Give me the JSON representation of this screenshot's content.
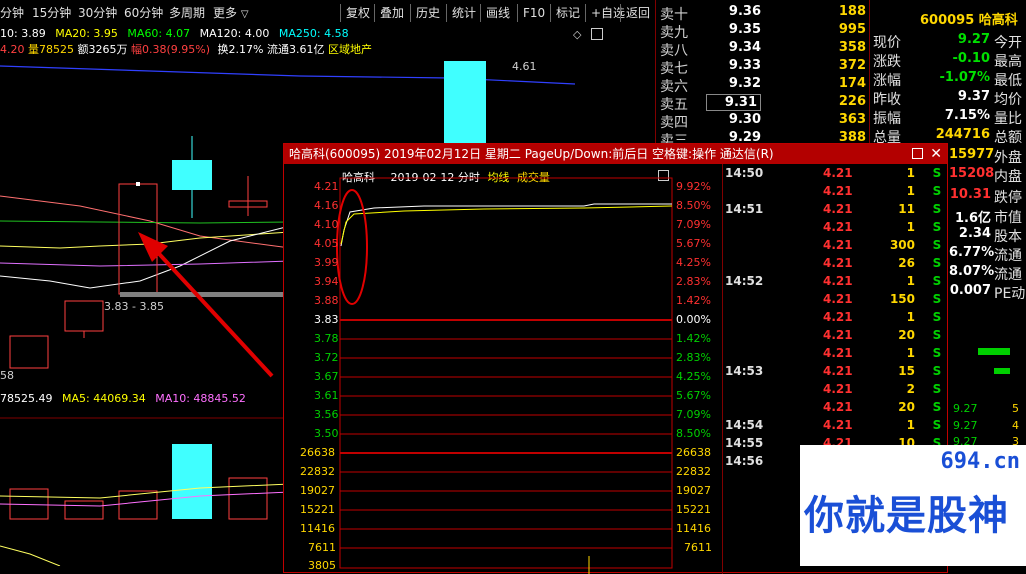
{
  "toolbar": {
    "periods": [
      "分钟",
      "15分钟",
      "30分钟",
      "60分钟",
      "多周期",
      "更多"
    ],
    "buttons": [
      "复权",
      "叠加",
      "历史",
      "统计",
      "画线",
      "F10",
      "标记",
      "+自选",
      "返回"
    ]
  },
  "main_chart": {
    "ma_line": [
      "10: 3.89",
      "MA20: 3.95",
      "MA60: 4.07",
      "MA120: 4.00",
      "MA250: 4.58"
    ],
    "info_line": {
      "price": "4.20",
      "vol": "量78525",
      "amount": "额3265万",
      "change": "幅0.38(9.95%)",
      "turnover": "换2.17%",
      "float": "流通3.61亿",
      "sector": "区域地产"
    },
    "high_label": "4.61",
    "low_label": "3.83 - 3.85",
    "left_low": "58",
    "vol_line": [
      "78525.49",
      "MA5: 44069.34",
      "MA10: 48845.52"
    ]
  },
  "quote": {
    "asks": [
      {
        "label": "卖十",
        "price": "9.36",
        "vol": "188"
      },
      {
        "label": "卖九",
        "price": "9.35",
        "vol": "995"
      },
      {
        "label": "卖八",
        "price": "9.34",
        "vol": "358"
      },
      {
        "label": "卖七",
        "price": "9.33",
        "vol": "372"
      },
      {
        "label": "卖六",
        "price": "9.32",
        "vol": "174"
      },
      {
        "label": "卖五",
        "price": "9.31",
        "vol": "226"
      },
      {
        "label": "卖四",
        "price": "9.30",
        "vol": "363"
      },
      {
        "label": "卖三",
        "price": "9.29",
        "vol": "388"
      }
    ]
  },
  "stats": {
    "code_name": "600095 哈高科",
    "rows": [
      {
        "label": "现价",
        "value": "9.27",
        "right": "今开"
      },
      {
        "label": "涨跌",
        "value": "-0.10",
        "right": "最高"
      },
      {
        "label": "涨幅",
        "value": "-1.07%",
        "right": "最低"
      },
      {
        "label": "昨收",
        "value": "9.37",
        "right": "均价"
      },
      {
        "label": "振幅",
        "value": "7.15%",
        "right": "量比"
      },
      {
        "label": "总量",
        "value": "244716",
        "right": "总额"
      }
    ],
    "below_rows": [
      {
        "value": "15977",
        "right": "外盘"
      },
      {
        "value": "15208",
        "right": "内盘"
      },
      {
        "value": "10.31",
        "right": "跌停"
      },
      {
        "value": "1.6亿",
        "right": "市值"
      },
      {
        "value": "2.34",
        "right": "股本"
      },
      {
        "value": "6.77%",
        "right": "流通"
      },
      {
        "value": "8.07%",
        "right": "流通"
      },
      {
        "value": "0.007",
        "right": "PE动"
      }
    ],
    "small_rows": [
      {
        "price": "9.27",
        "vol": "5"
      },
      {
        "price": "9.27",
        "vol": "4"
      },
      {
        "price": "9.27",
        "vol": "3"
      }
    ]
  },
  "popup": {
    "title": "哈高科(600095) 2019年02月12日 星期二 PageUp/Down:前后日 空格键:操作 通达信(R)",
    "subtitle": {
      "name": "哈高科",
      "date": "2019-02-12 分时",
      "avg": "均线",
      "vol": "成交量"
    },
    "price_ticks": [
      "4.21",
      "4.16",
      "4.10",
      "4.05",
      "3.99",
      "3.94",
      "3.88",
      "3.83",
      "3.78",
      "3.72",
      "3.67",
      "3.61",
      "3.56",
      "3.50"
    ],
    "pct_ticks": [
      "9.92%",
      "8.50%",
      "7.09%",
      "5.67%",
      "4.25%",
      "2.83%",
      "1.42%",
      "0.00%",
      "1.42%",
      "2.83%",
      "4.25%",
      "5.67%",
      "7.09%",
      "8.50%"
    ],
    "vol_ticks": [
      "26638",
      "22832",
      "19027",
      "15221",
      "11416",
      "7611",
      "3805"
    ],
    "ticks": [
      {
        "time": "14:50",
        "price": "4.21",
        "vol": "1",
        "s": "S"
      },
      {
        "time": "",
        "price": "4.21",
        "vol": "1",
        "s": "S"
      },
      {
        "time": "14:51",
        "price": "4.21",
        "vol": "11",
        "s": "S"
      },
      {
        "time": "",
        "price": "4.21",
        "vol": "1",
        "s": "S"
      },
      {
        "time": "",
        "price": "4.21",
        "vol": "300",
        "s": "S"
      },
      {
        "time": "",
        "price": "4.21",
        "vol": "26",
        "s": "S"
      },
      {
        "time": "14:52",
        "price": "4.21",
        "vol": "1",
        "s": "S"
      },
      {
        "time": "",
        "price": "4.21",
        "vol": "150",
        "s": "S"
      },
      {
        "time": "",
        "price": "4.21",
        "vol": "1",
        "s": "S"
      },
      {
        "time": "",
        "price": "4.21",
        "vol": "20",
        "s": "S"
      },
      {
        "time": "",
        "price": "4.21",
        "vol": "1",
        "s": "S"
      },
      {
        "time": "14:53",
        "price": "4.21",
        "vol": "15",
        "s": "S"
      },
      {
        "time": "",
        "price": "4.21",
        "vol": "2",
        "s": "S"
      },
      {
        "time": "",
        "price": "4.21",
        "vol": "20",
        "s": "S"
      },
      {
        "time": "14:54",
        "price": "4.21",
        "vol": "1",
        "s": "S"
      },
      {
        "time": "14:55",
        "price": "4.21",
        "vol": "10",
        "s": "S"
      },
      {
        "time": "14:56",
        "price": "",
        "vol": "",
        "s": ""
      }
    ]
  },
  "watermark": {
    "url": "694.cn",
    "slogan": "你就是股神"
  }
}
